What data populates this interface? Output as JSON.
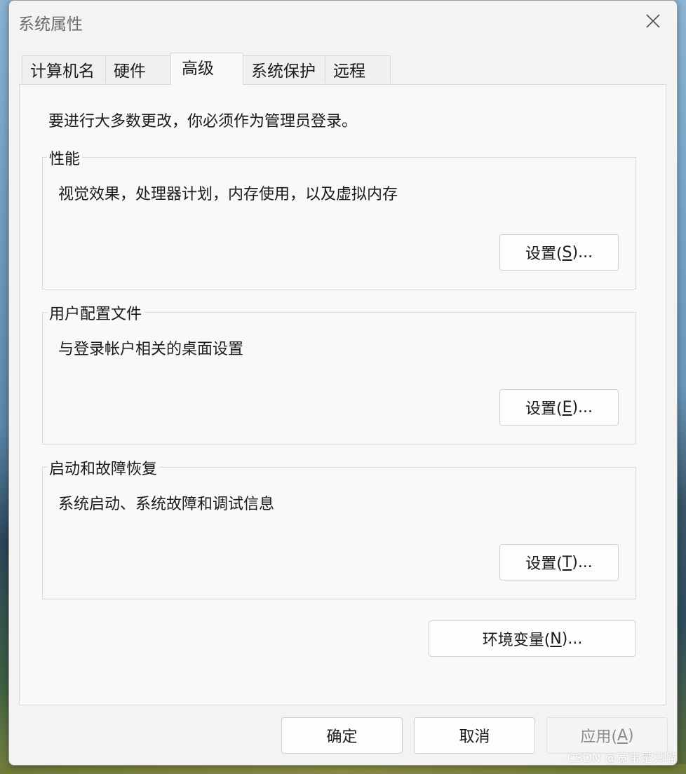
{
  "window": {
    "title": "系统属性"
  },
  "tabs": [
    {
      "label": "计算机名"
    },
    {
      "label": "硬件"
    },
    {
      "label": "高级"
    },
    {
      "label": "系统保护"
    },
    {
      "label": "远程"
    }
  ],
  "advanced": {
    "intro": "要进行大多数更改，你必须作为管理员登录。",
    "performance": {
      "title": "性能",
      "description": "视觉效果，处理器计划，内存使用，以及虚拟内存",
      "button_prefix": "设置(",
      "button_key": "S",
      "button_suffix": ")..."
    },
    "user_profiles": {
      "title": "用户配置文件",
      "description": "与登录帐户相关的桌面设置",
      "button_prefix": "设置(",
      "button_key": "E",
      "button_suffix": ")..."
    },
    "startup_recovery": {
      "title": "启动和故障恢复",
      "description": "系统启动、系统故障和调试信息",
      "button_prefix": "设置(",
      "button_key": "T",
      "button_suffix": ")..."
    },
    "env_vars": {
      "button_prefix": "环境变量(",
      "button_key": "N",
      "button_suffix": ")..."
    }
  },
  "footer": {
    "ok_label": "确定",
    "cancel_label": "取消",
    "apply_prefix": "应用(",
    "apply_key": "A",
    "apply_suffix": ")",
    "apply_enabled": false
  },
  "watermark": "CSDN @宽带是只喵",
  "colors": {
    "dialog_bg": "#f3f3f3",
    "panel_bg": "#f9f9f9",
    "border": "#d9d9d9",
    "disabled_text": "#8c8c8c"
  }
}
